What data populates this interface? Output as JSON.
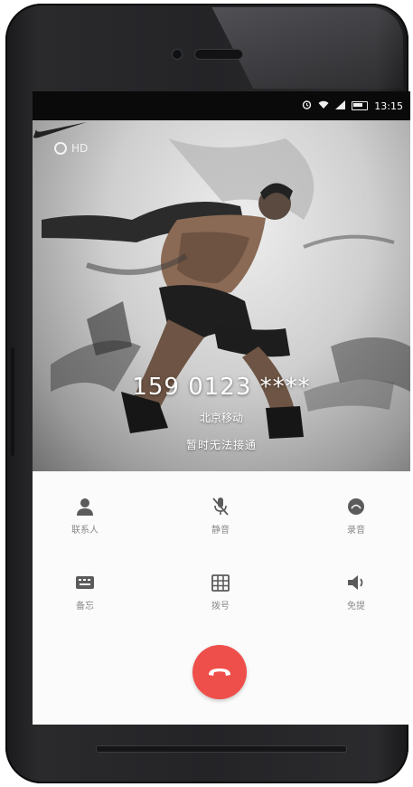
{
  "status_bar": {
    "time": "13:15",
    "icons": [
      "alarm-icon",
      "wifi-icon",
      "signal-icon",
      "battery-icon"
    ]
  },
  "hero": {
    "hd_badge": "HD",
    "brand_logo": "swoosh-logo",
    "caller_number": "159 0123 ****",
    "caller_location": "北京移动",
    "call_status": "暂时无法接通"
  },
  "controls": {
    "row1": [
      {
        "label": "联系人",
        "icon": "person-icon"
      },
      {
        "label": "静音",
        "icon": "mic-off-icon"
      },
      {
        "label": "录音",
        "icon": "record-icon"
      }
    ],
    "row2": [
      {
        "label": "备忘",
        "icon": "keyboard-icon"
      },
      {
        "label": "拨号",
        "icon": "dialpad-icon"
      },
      {
        "label": "免提",
        "icon": "speaker-icon"
      }
    ],
    "hangup_icon": "hangup-icon"
  },
  "colors": {
    "hangup": "#ef4f4b",
    "icon": "#5b5b5b",
    "label": "#8a8a8a",
    "panel": "#fbfbfb"
  }
}
